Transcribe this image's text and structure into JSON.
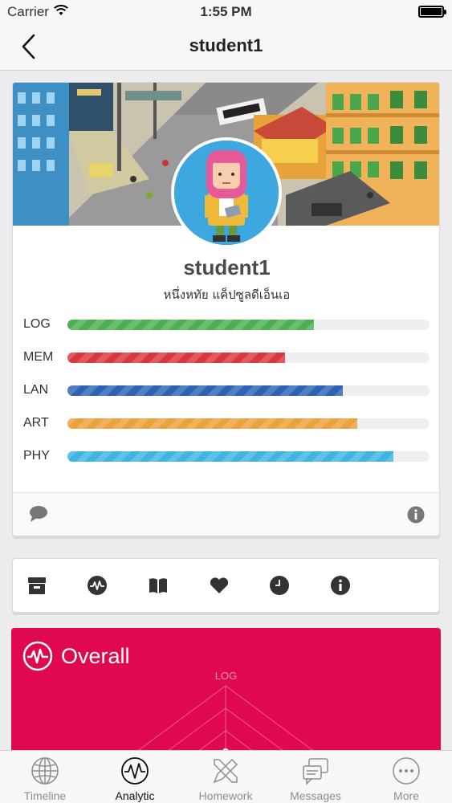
{
  "status_bar": {
    "carrier": "Carrier",
    "time": "1:55 PM"
  },
  "nav": {
    "title": "student1",
    "back_icon": "chevron-left-icon"
  },
  "profile": {
    "name": "student1",
    "subtitle": "หนึ่งหทัย แค็ปซูลดีเอ็นเอ",
    "stats": [
      {
        "label": "LOG",
        "value": 0.68,
        "color": "#4caf50"
      },
      {
        "label": "MEM",
        "value": 0.6,
        "color": "#d9363e"
      },
      {
        "label": "LAN",
        "value": 0.76,
        "color": "#2c63b5"
      },
      {
        "label": "ART",
        "value": 0.8,
        "color": "#eba13c"
      },
      {
        "label": "PHY",
        "value": 0.9,
        "color": "#3fb3e2"
      }
    ],
    "footer_icons": [
      "comment-icon",
      "info-icon"
    ]
  },
  "icon_row": [
    "archive-icon",
    "activity-icon",
    "book-icon",
    "heart-icon",
    "clock-icon",
    "info-icon"
  ],
  "overall": {
    "title": "Overall",
    "radar_top_label": "LOG"
  },
  "tabs": [
    {
      "label": "Timeline",
      "icon": "globe-icon",
      "active": false
    },
    {
      "label": "Analytic",
      "icon": "activity-icon",
      "active": true
    },
    {
      "label": "Homework",
      "icon": "pencil-ruler-icon",
      "active": false
    },
    {
      "label": "Messages",
      "icon": "chat-icon",
      "active": false
    },
    {
      "label": "More",
      "icon": "more-icon",
      "active": false
    }
  ],
  "colors": {
    "accent": "#e0084f",
    "nav_bg": "#f7f7f7"
  }
}
